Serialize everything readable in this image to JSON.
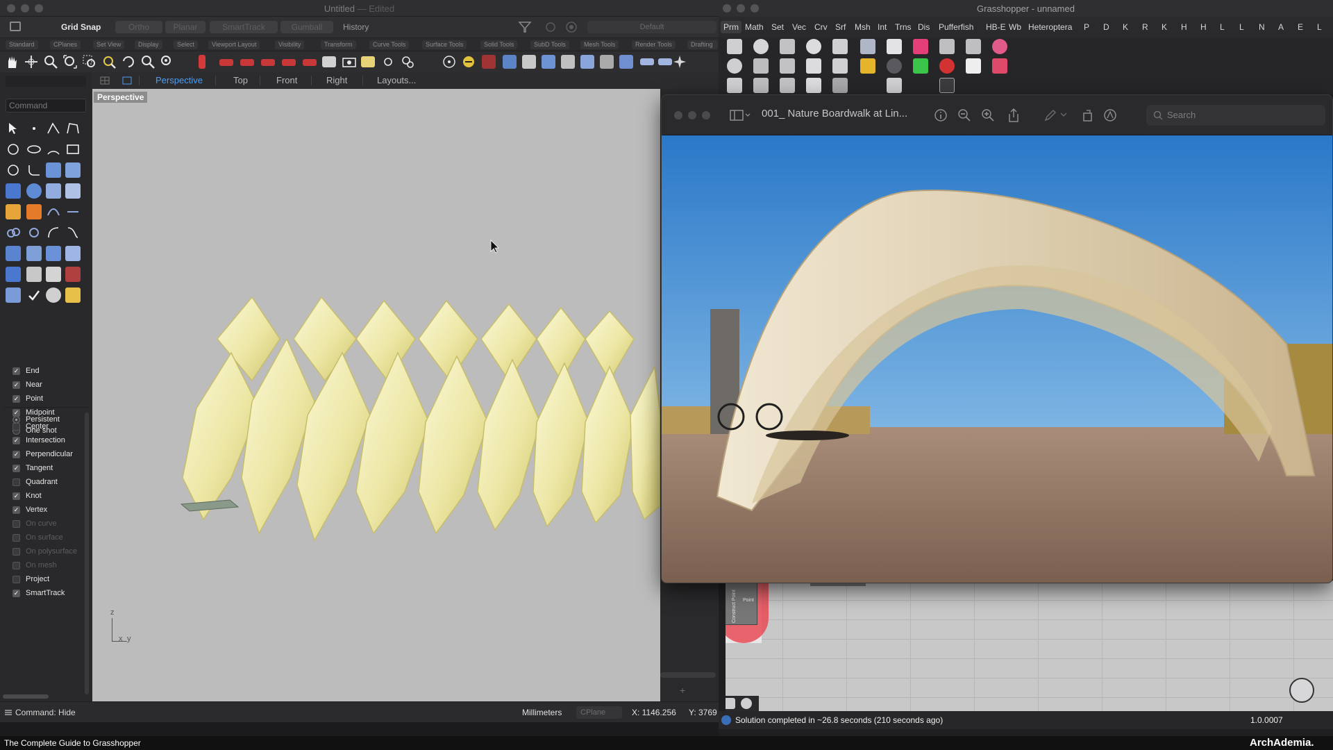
{
  "rhino": {
    "title": "Untitled",
    "title_sep": "—",
    "title_state": "Edited",
    "toolbar": {
      "grid_snap": "Grid Snap",
      "ortho": "Ortho",
      "planar": "Planar",
      "smarttrack": "SmartTrack",
      "gumball": "Gumball",
      "history": "History",
      "default_layer": "Default"
    },
    "tab_strip": [
      "Standard",
      "CPlanes",
      "Set View",
      "Display",
      "Select",
      "Viewport Layout",
      "Visibility",
      "Transform",
      "Curve Tools",
      "Surface Tools",
      "Solid Tools",
      "SubD Tools",
      "Mesh Tools",
      "Render Tools",
      "Drafting"
    ],
    "view_tabs": {
      "perspective": "Perspective",
      "top": "Top",
      "front": "Front",
      "right": "Right",
      "layouts": "Layouts..."
    },
    "command_placeholder": "Command",
    "viewport_label": "Perspective",
    "axis": {
      "z": "z",
      "x": "x",
      "y": "y"
    },
    "osnap": {
      "persistent": "Persistent",
      "one_shot": "One shot",
      "items": [
        {
          "label": "End",
          "checked": true,
          "enabled": true
        },
        {
          "label": "Near",
          "checked": true,
          "enabled": true
        },
        {
          "label": "Point",
          "checked": true,
          "enabled": true
        },
        {
          "label": "Midpoint",
          "checked": true,
          "enabled": true
        },
        {
          "label": "Center",
          "checked": false,
          "enabled": true
        },
        {
          "label": "Intersection",
          "checked": true,
          "enabled": true
        },
        {
          "label": "Perpendicular",
          "checked": true,
          "enabled": true
        },
        {
          "label": "Tangent",
          "checked": true,
          "enabled": true
        },
        {
          "label": "Quadrant",
          "checked": false,
          "enabled": true
        },
        {
          "label": "Knot",
          "checked": true,
          "enabled": true
        },
        {
          "label": "Vertex",
          "checked": true,
          "enabled": true
        },
        {
          "label": "On curve",
          "checked": false,
          "enabled": false
        },
        {
          "label": "On surface",
          "checked": false,
          "enabled": false
        },
        {
          "label": "On polysurface",
          "checked": false,
          "enabled": false
        },
        {
          "label": "On mesh",
          "checked": false,
          "enabled": false
        },
        {
          "label": "Project",
          "checked": false,
          "enabled": true
        },
        {
          "label": "SmartTrack",
          "checked": true,
          "enabled": true
        }
      ]
    },
    "status": {
      "command": "Command: Hide",
      "units": "Millimeters",
      "cplane": "CPlane",
      "x": "X: 1146.256",
      "y": "Y: 3769"
    }
  },
  "grasshopper": {
    "title": "Grasshopper - unnamed",
    "menu": [
      "Prm",
      "Math",
      "Set",
      "Vec",
      "Crv",
      "Srf",
      "Msh",
      "Int",
      "Trns",
      "Dis",
      "Pufferfish",
      "HB-E",
      "Wb",
      "Heteroptera",
      "P",
      "D",
      "K",
      "R",
      "K",
      "H",
      "H",
      "L",
      "L",
      "N",
      "A",
      "E",
      "L"
    ],
    "status": "Solution completed in ~26.8 seconds (210 seconds ago)",
    "version": "1.0.0007",
    "node_label": "Construct Point",
    "node_output": "Point"
  },
  "preview": {
    "title": "001_ Nature Boardwalk at Lin...",
    "search_placeholder": "Search"
  },
  "caption": {
    "left": "The Complete Guide to Grasshopper",
    "right": "ArchAdemia."
  },
  "colors": {
    "accent": "#4b9ef4",
    "model": "#f3efb8",
    "viewport_bg": "#bcbcbc"
  }
}
